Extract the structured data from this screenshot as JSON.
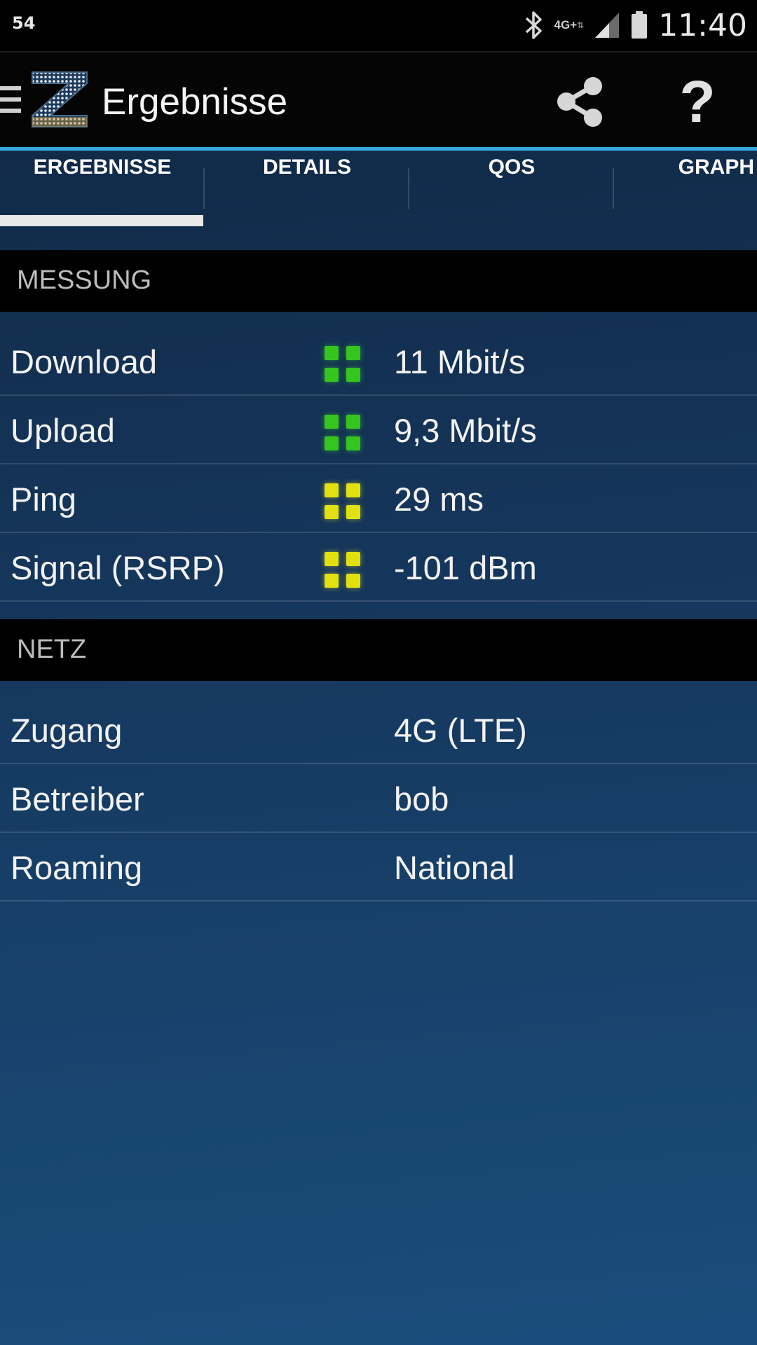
{
  "status_bar": {
    "left_text": "54",
    "network_type": "4G+",
    "time": "11:40"
  },
  "app_bar": {
    "title": "Ergebnisse",
    "logo_letter": "Z",
    "help_label": "?"
  },
  "tabs": [
    {
      "label": "ERGEBNISSE",
      "selected": true
    },
    {
      "label": "DETAILS",
      "selected": false
    },
    {
      "label": "QOS",
      "selected": false
    },
    {
      "label": "GRAPH",
      "selected": false
    }
  ],
  "sections": {
    "measurement": {
      "title": "MESSUNG",
      "rows": [
        {
          "label": "Download",
          "value": "11 Mbit/s",
          "quality": "green"
        },
        {
          "label": "Upload",
          "value": "9,3 Mbit/s",
          "quality": "green"
        },
        {
          "label": "Ping",
          "value": "29 ms",
          "quality": "yellow"
        },
        {
          "label": "Signal (RSRP)",
          "value": "-101 dBm",
          "quality": "yellow"
        }
      ]
    },
    "network": {
      "title": "NETZ",
      "rows": [
        {
          "label": "Zugang",
          "value": "4G (LTE)"
        },
        {
          "label": "Betreiber",
          "value": "bob"
        },
        {
          "label": "Roaming",
          "value": "National"
        }
      ]
    }
  },
  "colors": {
    "accent": "#35a8e0",
    "quality_green": "#35c51e",
    "quality_yellow": "#e1e10f"
  }
}
